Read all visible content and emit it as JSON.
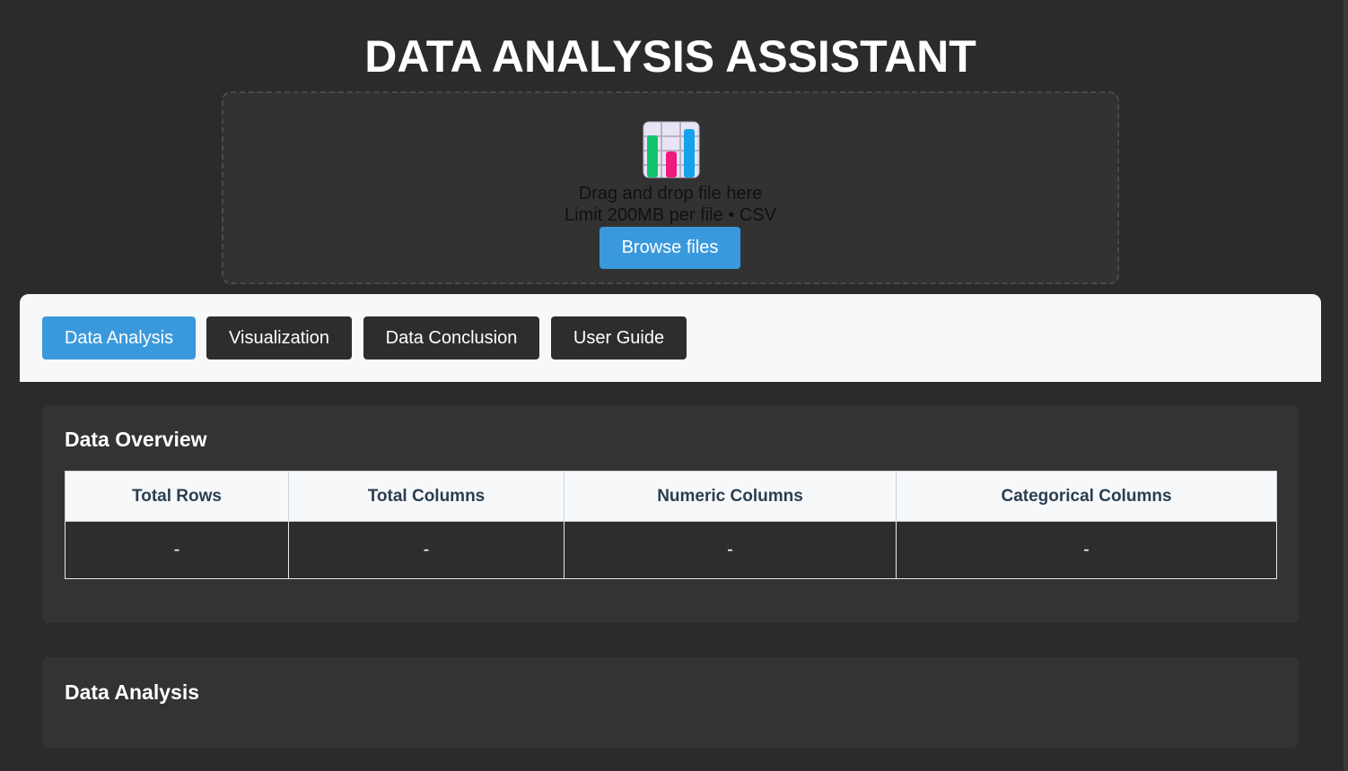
{
  "app": {
    "title": "DATA ANALYSIS ASSISTANT"
  },
  "uploader": {
    "icon": "bar-chart-icon",
    "drag_text": "Drag and drop file here",
    "limit_text": "Limit 200MB per file • CSV",
    "browse_label": "Browse files"
  },
  "tabs": [
    {
      "label": "Data Analysis",
      "active": true
    },
    {
      "label": "Visualization",
      "active": false
    },
    {
      "label": "Data Conclusion",
      "active": false
    },
    {
      "label": "User Guide",
      "active": false
    }
  ],
  "overview": {
    "title": "Data Overview",
    "columns": [
      "Total Rows",
      "Total Columns",
      "Numeric Columns",
      "Categorical Columns"
    ],
    "values": [
      "-",
      "-",
      "-",
      "-"
    ]
  },
  "analysis": {
    "title": "Data Analysis"
  },
  "colors": {
    "background": "#2b2b2b",
    "accent": "#3a99dc",
    "card": "#333333",
    "tab_bar": "#f7f8fa"
  }
}
